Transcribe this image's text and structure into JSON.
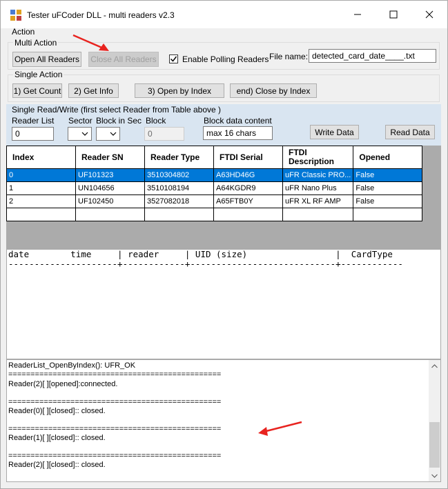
{
  "window": {
    "title": "Tester uFCoder DLL - multi readers v2.3",
    "minimize_glyph": "—",
    "maximize_glyph": "☐",
    "close_glyph": "✕"
  },
  "action_group": {
    "label": "Action",
    "multi_action": {
      "label": "Multi Action",
      "open_all": "Open All Readers",
      "close_all": "Close All Readers",
      "enable_polling": "Enable Polling Readers",
      "enable_polling_checked": true,
      "file_name_label": "File name:",
      "file_name_value": "detected_card_date____.txt"
    },
    "single_action": {
      "label": "Single Action",
      "get_count": "1) Get Count",
      "get_info": "2) Get Info",
      "open_by_index": "3) Open by Index",
      "close_by_index": "end) Close by Index"
    }
  },
  "single_rw": {
    "title": "Single Read/Write  (first select Reader from Table above )",
    "reader_list_label": "Reader List",
    "reader_list_value": "0",
    "sector_label": "Sector",
    "block_in_sec_label": "Block in Sec",
    "block_label": "Block",
    "block_value": "0",
    "block_data_label": "Block data content",
    "block_data_value": "max 16 chars",
    "write_data": "Write Data",
    "read_data": "Read Data"
  },
  "readers_table": {
    "columns": [
      "Index",
      "Reader SN",
      "Reader Type",
      "FTDI Serial",
      "FTDI Description",
      "Opened"
    ],
    "rows": [
      [
        "0",
        "UF101323",
        "3510304802",
        "A63HD46G",
        "uFR Classic PRO...",
        "False"
      ],
      [
        "1",
        "UN104656",
        "3510108194",
        "A64KGDR9",
        "uFR Nano Plus",
        "False"
      ],
      [
        "2",
        "UF102450",
        "3527082018",
        "A65FTB0Y",
        "uFR XL RF AMP",
        "False"
      ]
    ],
    "selected_row": 0
  },
  "log_header": {
    "line1": "date        time     | reader     | UID (size)                 |  CardType",
    "line2": "---------------------+------------+----------------------------+------------"
  },
  "log": {
    "lines": [
      "ReaderList_OpenByIndex(): UFR_OK",
      "================================================",
      "Reader(2)[ ][opened]:connected.",
      "",
      "================================================",
      "Reader(0)[ ][closed]:: closed.",
      "",
      "================================================",
      "Reader(1)[ ][closed]:: closed.",
      "",
      "================================================",
      "Reader(2)[ ][closed]:: closed."
    ]
  },
  "colors": {
    "selection": "#0078d7",
    "annotation_arrow": "#e8231f",
    "panel_blue": "#d9e5f1"
  }
}
